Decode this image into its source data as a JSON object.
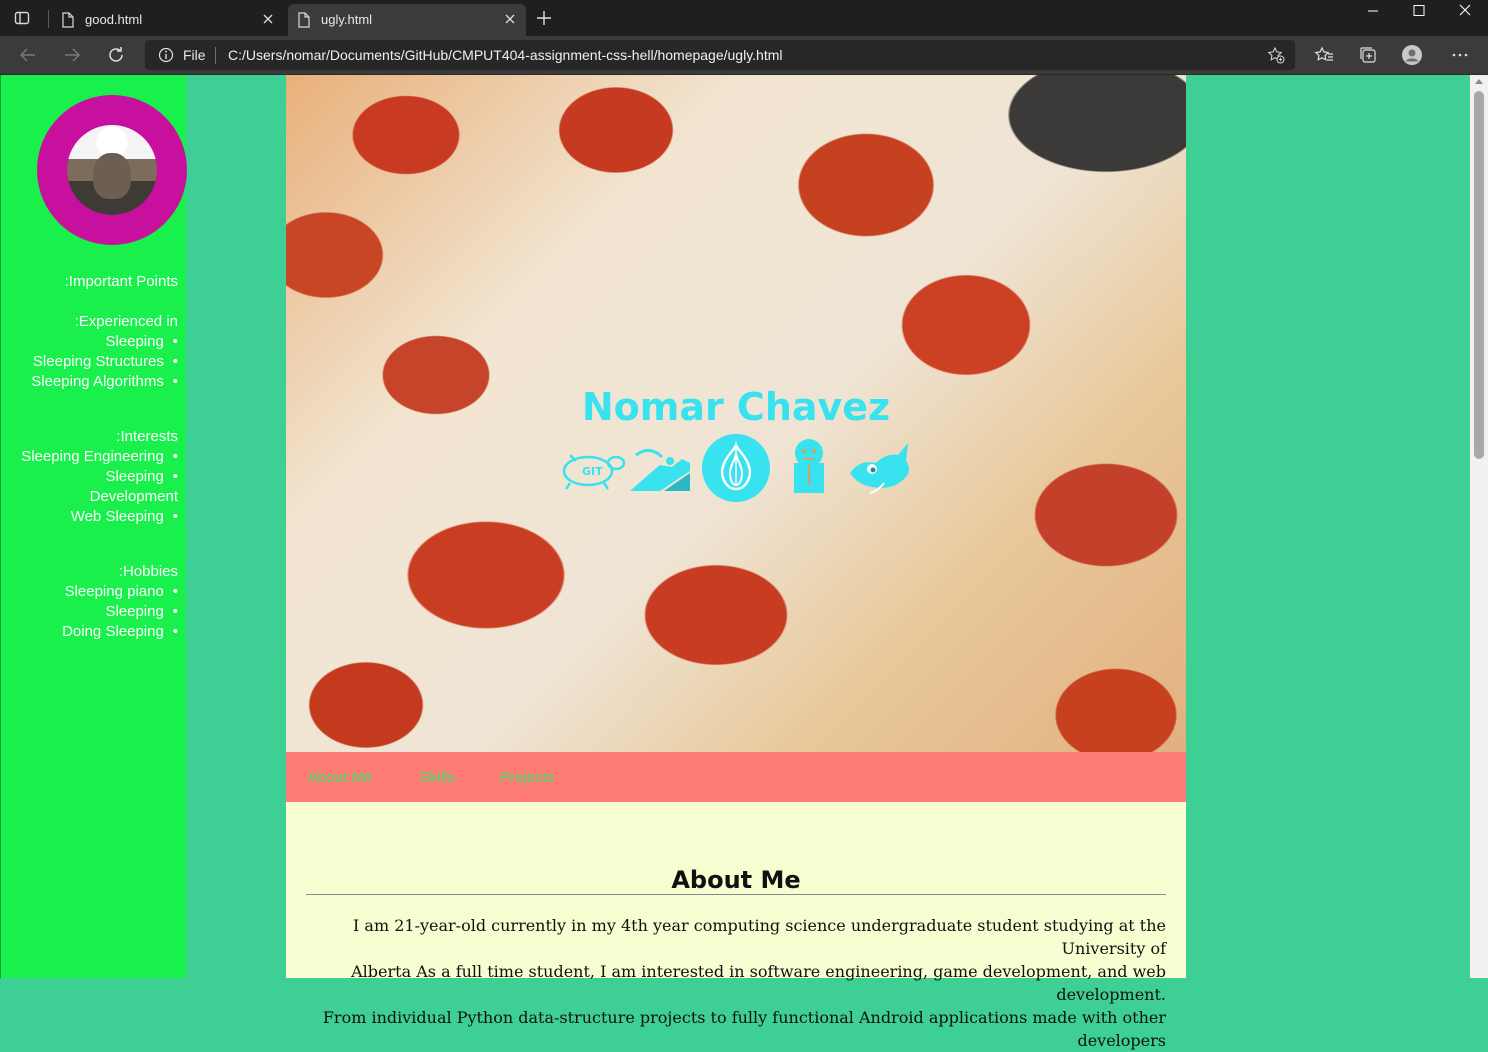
{
  "browser": {
    "tabs": [
      {
        "title": "good.html"
      },
      {
        "title": "ugly.html"
      }
    ],
    "address": {
      "scheme_label": "File",
      "url": "C:/Users/nomar/Documents/GitHub/CMPUT404-assignment-css-hell/homepage/ugly.html"
    }
  },
  "sidebar": {
    "sections": [
      {
        "heading": ":Important Points"
      },
      {
        "heading": ":Experienced in",
        "items": [
          "Sleeping",
          "Sleeping Structures",
          "Sleeping Algorithms"
        ]
      },
      {
        "heading": ":Interests",
        "items": [
          "Sleeping Engineering",
          "Sleeping",
          "Development",
          "Web Sleeping"
        ]
      },
      {
        "heading": ":Hobbies",
        "items": [
          "Sleeping piano",
          "Sleeping",
          "Doing Sleeping"
        ]
      }
    ]
  },
  "header": {
    "name": "Nomar Chavez",
    "icons": [
      "git-icon",
      "scratch-cat-icon",
      "onion-icon",
      "jenkins-icon",
      "gimp-icon"
    ]
  },
  "nav": {
    "links": [
      "About Me",
      "Skills",
      "Projects"
    ]
  },
  "about": {
    "title": "About Me",
    "lines": [
      "I am 21-year-old currently in my 4th year computing science undergraduate student studying at the University of",
      "Alberta As a full time student, I am interested in software engineering, game development, and web development.",
      "From individual Python data-structure projects to fully functional Android applications made with other developers"
    ]
  },
  "colors": {
    "page_bg": "#3ecf94",
    "sidebar_bg": "#19f04c",
    "avatar_ring": "#c8109e",
    "title_color": "#38e2ee",
    "nav_bg": "#ff7b76",
    "nav_link": "#3ee26a",
    "content_bg": "#f6fdd0"
  }
}
